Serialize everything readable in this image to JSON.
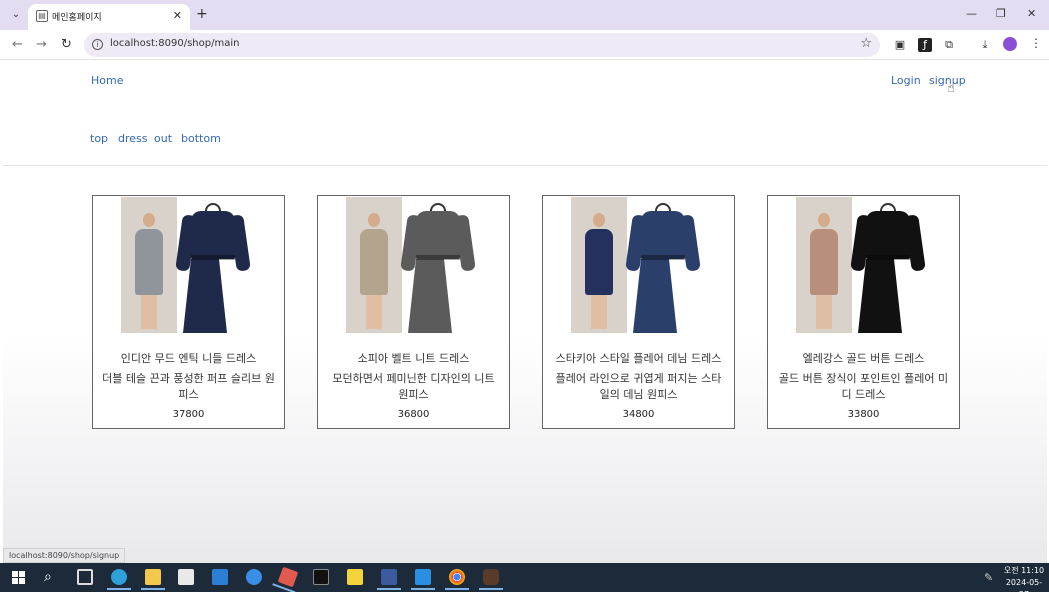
{
  "browser": {
    "tab_title": "메인홈페이지",
    "new_tab": "+",
    "close": "✕",
    "url": "localhost:8090/shop/main",
    "status_url": "localhost:8090/shop/signup"
  },
  "header": {
    "home": "Home",
    "login": "Login",
    "signup": "signup"
  },
  "categories": [
    "top",
    "dress",
    "out",
    "bottom"
  ],
  "products": [
    {
      "name": "인디안 무드 엔틱 니들 드레스",
      "desc": "더블 테슬 끈과 풍성한 퍼프 슬리브 원피스",
      "price": "37800",
      "model_color": "#8f959a",
      "dress_color": "#1f2a4a"
    },
    {
      "name": "소피아 벨트 니트 드레스",
      "desc": "모던하면서 페미닌한 디자인의 니트 원피스",
      "price": "36800",
      "model_color": "#b3a58d",
      "dress_color": "#5b5b5b"
    },
    {
      "name": "스타키아 스타일 플레어 데님 드레스",
      "desc": "플레어 라인으로 귀엽게 퍼지는 스타일의 데님 원피스",
      "price": "34800",
      "model_color": "#24305e",
      "dress_color": "#2b3f6b"
    },
    {
      "name": "엘레강스 골드 버튼 드레스",
      "desc": "골드 버튼 장식이 포인트인 플레어 미디 드레스",
      "price": "33800",
      "model_color": "#b88f7a",
      "dress_color": "#111111"
    }
  ],
  "taskbar": {
    "time": "오전 11:10",
    "date": "2024-05-27"
  }
}
